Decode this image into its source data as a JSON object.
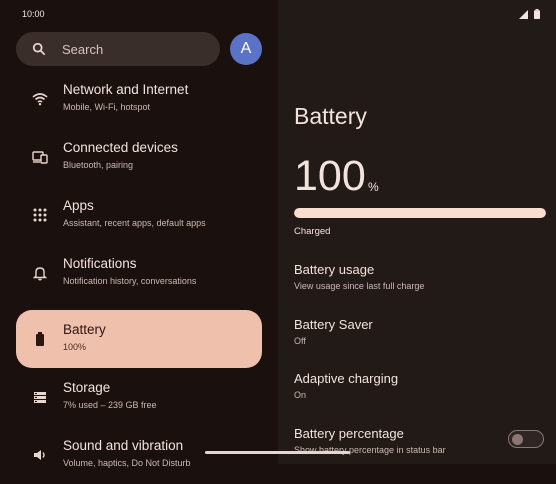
{
  "status": {
    "time": "10:00",
    "icons": [
      "signal-icon",
      "battery-icon"
    ]
  },
  "search": {
    "placeholder": "Search",
    "icon": "search-icon"
  },
  "account": {
    "avatar_letter": "A",
    "color": "#5b73c7"
  },
  "nav": {
    "items": [
      {
        "title": "Network and Internet",
        "subtitle": "Mobile, Wi-Fi, hotspot",
        "icon": "wifi-icon",
        "active": false
      },
      {
        "title": "Connected devices",
        "subtitle": "Bluetooth, pairing",
        "icon": "devices-icon",
        "active": false
      },
      {
        "title": "Apps",
        "subtitle": "Assistant, recent apps, default apps",
        "icon": "apps-grid-icon",
        "active": false
      },
      {
        "title": "Notifications",
        "subtitle": "Notification history, conversations",
        "icon": "bell-icon",
        "active": false
      },
      {
        "title": "Battery",
        "subtitle": "100%",
        "icon": "battery-icon",
        "active": true
      },
      {
        "title": "Storage",
        "subtitle": "7% used – 239 GB free",
        "icon": "storage-icon",
        "active": false
      },
      {
        "title": "Sound and vibration",
        "subtitle": "Volume, haptics, Do Not Disturb",
        "icon": "speaker-icon",
        "active": false
      }
    ]
  },
  "battery": {
    "title": "Battery",
    "level": "100",
    "unit": "%",
    "level_fraction": 1.0,
    "status": "Charged",
    "settings": [
      {
        "title": "Battery usage",
        "subtitle": "View usage since last full charge"
      },
      {
        "title": "Battery Saver",
        "subtitle": "Off"
      },
      {
        "title": "Adaptive charging",
        "subtitle": "On"
      },
      {
        "title": "Battery percentage",
        "subtitle": "Show battery percentage in status bar",
        "toggle_on": false
      }
    ]
  },
  "colors": {
    "background": "#1a110f",
    "panel": "#221a17",
    "active_item": "#efc0ac",
    "bar_fill": "#f8ddd1"
  }
}
